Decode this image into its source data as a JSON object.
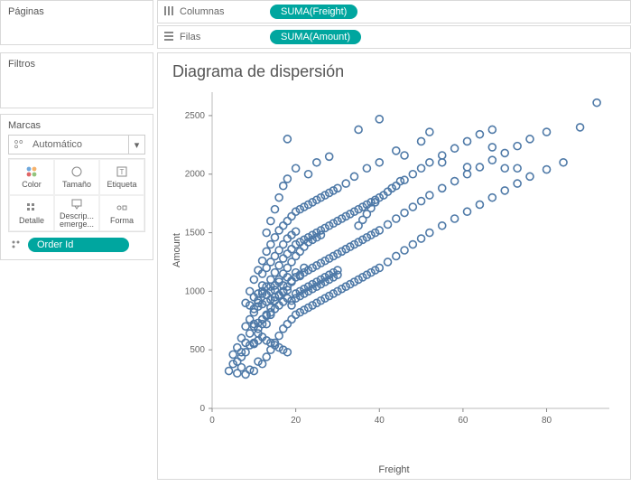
{
  "panels": {
    "paginas": "Páginas",
    "filtros": "Filtros",
    "marcas": "Marcas"
  },
  "marks": {
    "select_label": "Automático",
    "grid": [
      "Color",
      "Tamaño",
      "Etiqueta",
      "Detalle",
      "Descrip... emerge...",
      "Forma"
    ]
  },
  "detail_pill": "Order Id",
  "shelves": {
    "columns_label": "Columnas",
    "columns_pill": "SUMA(Freight)",
    "rows_label": "Filas",
    "rows_pill": "SUMA(Amount)"
  },
  "chart": {
    "title": "Diagrama de dispersión",
    "xlabel": "Freight",
    "ylabel": "Amount"
  },
  "chart_data": {
    "type": "scatter",
    "xlabel": "Freight",
    "ylabel": "Amount",
    "title": "Diagrama de dispersión",
    "xlim": [
      0,
      95
    ],
    "ylim": [
      0,
      2700
    ],
    "x_ticks": [
      0,
      20,
      40,
      60,
      80
    ],
    "y_ticks": [
      0,
      500,
      1000,
      1500,
      2000,
      2500
    ],
    "mark_color": "#4e79a7",
    "points": [
      [
        4,
        320
      ],
      [
        5,
        380
      ],
      [
        5,
        460
      ],
      [
        6,
        300
      ],
      [
        6,
        520
      ],
      [
        7,
        350
      ],
      [
        7,
        440
      ],
      [
        7,
        600
      ],
      [
        8,
        290
      ],
      [
        8,
        480
      ],
      [
        8,
        700
      ],
      [
        9,
        330
      ],
      [
        9,
        540
      ],
      [
        9,
        760
      ],
      [
        9,
        1000
      ],
      [
        10,
        320
      ],
      [
        10,
        560
      ],
      [
        10,
        820
      ],
      [
        10,
        1100
      ],
      [
        11,
        400
      ],
      [
        11,
        640
      ],
      [
        11,
        900
      ],
      [
        11,
        1180
      ],
      [
        11,
        980
      ],
      [
        12,
        380
      ],
      [
        12,
        720
      ],
      [
        12,
        980
      ],
      [
        12,
        1260
      ],
      [
        12,
        1050
      ],
      [
        13,
        440
      ],
      [
        13,
        800
      ],
      [
        13,
        1040
      ],
      [
        13,
        1340
      ],
      [
        13,
        1500
      ],
      [
        14,
        500
      ],
      [
        14,
        860
      ],
      [
        14,
        1100
      ],
      [
        14,
        1400
      ],
      [
        14,
        1600
      ],
      [
        14,
        1000
      ],
      [
        15,
        560
      ],
      [
        15,
        920
      ],
      [
        15,
        1160
      ],
      [
        15,
        1460
      ],
      [
        15,
        1700
      ],
      [
        15,
        1050
      ],
      [
        16,
        620
      ],
      [
        16,
        960
      ],
      [
        16,
        1220
      ],
      [
        16,
        1520
      ],
      [
        16,
        1800
      ],
      [
        16,
        1100
      ],
      [
        17,
        680
      ],
      [
        17,
        1000
      ],
      [
        17,
        1280
      ],
      [
        17,
        1560
      ],
      [
        17,
        1900
      ],
      [
        17,
        1150
      ],
      [
        18,
        720
      ],
      [
        18,
        1040
      ],
      [
        18,
        1320
      ],
      [
        18,
        1600
      ],
      [
        18,
        1960
      ],
      [
        18,
        1200
      ],
      [
        18,
        2300
      ],
      [
        19,
        760
      ],
      [
        19,
        1080
      ],
      [
        19,
        1360
      ],
      [
        19,
        1640
      ],
      [
        19,
        1250
      ],
      [
        20,
        800
      ],
      [
        20,
        1120
      ],
      [
        20,
        1400
      ],
      [
        20,
        1680
      ],
      [
        20,
        1300
      ],
      [
        20,
        2050
      ],
      [
        21,
        820
      ],
      [
        21,
        1140
      ],
      [
        21,
        1420
      ],
      [
        21,
        1700
      ],
      [
        21,
        1340
      ],
      [
        22,
        840
      ],
      [
        22,
        1160
      ],
      [
        22,
        1440
      ],
      [
        22,
        1720
      ],
      [
        22,
        1380
      ],
      [
        23,
        860
      ],
      [
        23,
        1180
      ],
      [
        23,
        1460
      ],
      [
        23,
        1740
      ],
      [
        23,
        1420
      ],
      [
        23,
        2000
      ],
      [
        24,
        880
      ],
      [
        24,
        1200
      ],
      [
        24,
        1480
      ],
      [
        24,
        1760
      ],
      [
        24,
        1440
      ],
      [
        25,
        900
      ],
      [
        25,
        1220
      ],
      [
        25,
        1500
      ],
      [
        25,
        1780
      ],
      [
        25,
        1460
      ],
      [
        25,
        2100
      ],
      [
        26,
        920
      ],
      [
        26,
        1240
      ],
      [
        26,
        1520
      ],
      [
        26,
        1800
      ],
      [
        26,
        1480
      ],
      [
        27,
        940
      ],
      [
        27,
        1260
      ],
      [
        27,
        1540
      ],
      [
        27,
        1820
      ],
      [
        28,
        960
      ],
      [
        28,
        1280
      ],
      [
        28,
        1560
      ],
      [
        28,
        1840
      ],
      [
        28,
        2150
      ],
      [
        29,
        980
      ],
      [
        29,
        1300
      ],
      [
        29,
        1580
      ],
      [
        29,
        1860
      ],
      [
        30,
        1000
      ],
      [
        30,
        1320
      ],
      [
        30,
        1600
      ],
      [
        30,
        1880
      ],
      [
        31,
        1020
      ],
      [
        31,
        1340
      ],
      [
        31,
        1620
      ],
      [
        32,
        1040
      ],
      [
        32,
        1360
      ],
      [
        32,
        1640
      ],
      [
        32,
        1920
      ],
      [
        33,
        1060
      ],
      [
        33,
        1380
      ],
      [
        33,
        1660
      ],
      [
        34,
        1080
      ],
      [
        34,
        1400
      ],
      [
        34,
        1680
      ],
      [
        34,
        1980
      ],
      [
        35,
        1100
      ],
      [
        35,
        1420
      ],
      [
        35,
        1700
      ],
      [
        35,
        2380
      ],
      [
        36,
        1120
      ],
      [
        36,
        1440
      ],
      [
        36,
        1720
      ],
      [
        37,
        1140
      ],
      [
        37,
        1460
      ],
      [
        37,
        1740
      ],
      [
        37,
        2050
      ],
      [
        38,
        1160
      ],
      [
        38,
        1480
      ],
      [
        38,
        1760
      ],
      [
        39,
        1180
      ],
      [
        39,
        1500
      ],
      [
        39,
        1780
      ],
      [
        40,
        1200
      ],
      [
        40,
        1520
      ],
      [
        40,
        1800
      ],
      [
        40,
        2100
      ],
      [
        40,
        2470
      ],
      [
        42,
        1250
      ],
      [
        42,
        1570
      ],
      [
        42,
        1850
      ],
      [
        44,
        1300
      ],
      [
        44,
        1620
      ],
      [
        44,
        1900
      ],
      [
        44,
        2200
      ],
      [
        46,
        1350
      ],
      [
        46,
        1670
      ],
      [
        46,
        1950
      ],
      [
        46,
        2160
      ],
      [
        48,
        1400
      ],
      [
        48,
        1720
      ],
      [
        48,
        2000
      ],
      [
        50,
        1450
      ],
      [
        50,
        1770
      ],
      [
        50,
        2050
      ],
      [
        50,
        2280
      ],
      [
        52,
        1500
      ],
      [
        52,
        1820
      ],
      [
        52,
        2100
      ],
      [
        52,
        2360
      ],
      [
        55,
        1560
      ],
      [
        55,
        1880
      ],
      [
        55,
        2160
      ],
      [
        55,
        2100
      ],
      [
        58,
        1620
      ],
      [
        58,
        1940
      ],
      [
        58,
        2220
      ],
      [
        61,
        1680
      ],
      [
        61,
        2000
      ],
      [
        61,
        2280
      ],
      [
        61,
        2060
      ],
      [
        64,
        1740
      ],
      [
        64,
        2060
      ],
      [
        64,
        2340
      ],
      [
        67,
        1800
      ],
      [
        67,
        2120
      ],
      [
        67,
        2380
      ],
      [
        67,
        2230
      ],
      [
        70,
        1860
      ],
      [
        70,
        2180
      ],
      [
        70,
        2050
      ],
      [
        73,
        1920
      ],
      [
        73,
        2240
      ],
      [
        73,
        2050
      ],
      [
        76,
        1980
      ],
      [
        76,
        2300
      ],
      [
        80,
        2040
      ],
      [
        80,
        2360
      ],
      [
        84,
        2100
      ],
      [
        88,
        2400
      ],
      [
        92,
        2610
      ],
      [
        10,
        550
      ],
      [
        11,
        580
      ],
      [
        12,
        610
      ],
      [
        13,
        580
      ],
      [
        14,
        560
      ],
      [
        15,
        540
      ],
      [
        16,
        520
      ],
      [
        17,
        500
      ],
      [
        18,
        480
      ],
      [
        10,
        700
      ],
      [
        11,
        730
      ],
      [
        12,
        760
      ],
      [
        13,
        790
      ],
      [
        14,
        820
      ],
      [
        15,
        850
      ],
      [
        16,
        880
      ],
      [
        17,
        910
      ],
      [
        18,
        940
      ],
      [
        10,
        850
      ],
      [
        11,
        870
      ],
      [
        12,
        890
      ],
      [
        13,
        910
      ],
      [
        14,
        930
      ],
      [
        15,
        950
      ],
      [
        16,
        970
      ],
      [
        17,
        990
      ],
      [
        18,
        1010
      ],
      [
        19,
        880
      ],
      [
        19,
        920
      ],
      [
        20,
        940
      ],
      [
        20,
        980
      ],
      [
        21,
        960
      ],
      [
        21,
        1000
      ],
      [
        22,
        980
      ],
      [
        22,
        1020
      ],
      [
        23,
        1000
      ],
      [
        23,
        1040
      ],
      [
        24,
        1020
      ],
      [
        24,
        1060
      ],
      [
        25,
        1040
      ],
      [
        25,
        1080
      ],
      [
        26,
        1060
      ],
      [
        26,
        1100
      ],
      [
        27,
        1080
      ],
      [
        27,
        1120
      ],
      [
        28,
        1100
      ],
      [
        28,
        1140
      ],
      [
        29,
        1120
      ],
      [
        29,
        1160
      ],
      [
        30,
        1140
      ],
      [
        30,
        1180
      ],
      [
        12,
        1150
      ],
      [
        13,
        1200
      ],
      [
        14,
        1250
      ],
      [
        15,
        1300
      ],
      [
        16,
        1350
      ],
      [
        17,
        1400
      ],
      [
        18,
        1450
      ],
      [
        19,
        1480
      ],
      [
        20,
        1510
      ],
      [
        8,
        900
      ],
      [
        9,
        880
      ],
      [
        10,
        950
      ],
      [
        11,
        920
      ],
      [
        12,
        1000
      ],
      [
        13,
        970
      ],
      [
        14,
        1040
      ],
      [
        15,
        1010
      ],
      [
        16,
        1080
      ],
      [
        17,
        1050
      ],
      [
        18,
        1120
      ],
      [
        19,
        1090
      ],
      [
        20,
        1160
      ],
      [
        21,
        1130
      ],
      [
        22,
        1200
      ],
      [
        6,
        400
      ],
      [
        7,
        480
      ],
      [
        8,
        560
      ],
      [
        9,
        640
      ],
      [
        10,
        720
      ],
      [
        11,
        680
      ],
      [
        12,
        760
      ],
      [
        13,
        720
      ],
      [
        14,
        800
      ],
      [
        35,
        1560
      ],
      [
        36,
        1610
      ],
      [
        37,
        1660
      ],
      [
        38,
        1710
      ],
      [
        39,
        1760
      ],
      [
        41,
        1820
      ],
      [
        43,
        1880
      ],
      [
        45,
        1940
      ]
    ]
  }
}
